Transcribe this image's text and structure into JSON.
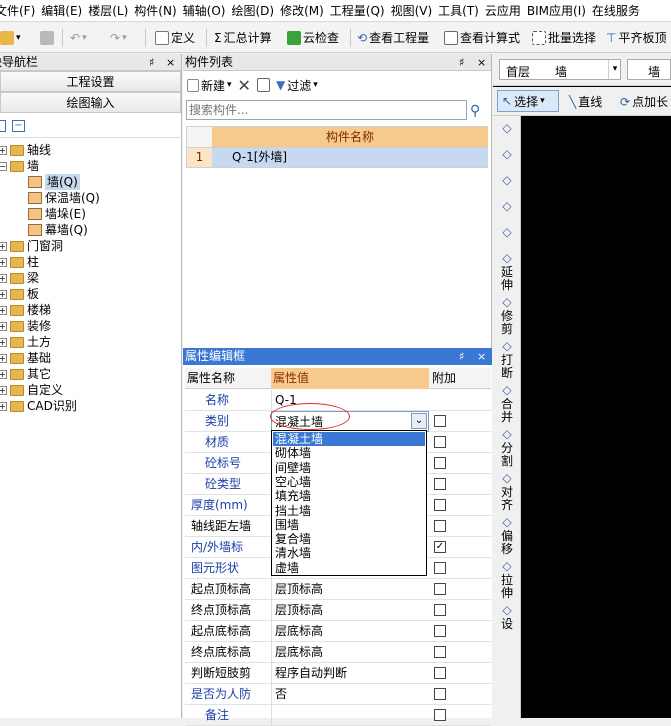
{
  "menu": [
    "文件(F)",
    "编辑(E)",
    "楼层(L)",
    "构件(N)",
    "辅轴(O)",
    "绘图(D)",
    "修改(M)",
    "工程量(Q)",
    "视图(V)",
    "工具(T)",
    "云应用",
    "BIM应用(I)",
    "在线服务"
  ],
  "toolbar": {
    "define": "定义",
    "sum": "汇总计算",
    "cloud_check": "云检查",
    "view_quantity": "查看工程量",
    "view_formula": "查看计算式",
    "batch_select": "批量选择",
    "flush_top": "平齐板顶"
  },
  "nav": {
    "title": "模块导航栏",
    "pin": "♯",
    "close": "×",
    "btn_project": "工程设置",
    "btn_draw": "绘图输入",
    "tree": [
      {
        "label": "轴线",
        "level": 0,
        "expand": "+",
        "type": "folder"
      },
      {
        "label": "墙",
        "level": 0,
        "expand": "-",
        "type": "folder"
      },
      {
        "label": "墙(Q)",
        "level": 1,
        "type": "wall",
        "selected": true
      },
      {
        "label": "保温墙(Q)",
        "level": 1,
        "type": "wall"
      },
      {
        "label": "墙垛(E)",
        "level": 1,
        "type": "wall"
      },
      {
        "label": "幕墙(Q)",
        "level": 1,
        "type": "wall"
      },
      {
        "label": "门窗洞",
        "level": 0,
        "expand": "+",
        "type": "folder"
      },
      {
        "label": "柱",
        "level": 0,
        "expand": "+",
        "type": "folder"
      },
      {
        "label": "梁",
        "level": 0,
        "expand": "+",
        "type": "folder"
      },
      {
        "label": "板",
        "level": 0,
        "expand": "+",
        "type": "folder"
      },
      {
        "label": "楼梯",
        "level": 0,
        "expand": "+",
        "type": "folder"
      },
      {
        "label": "装修",
        "level": 0,
        "expand": "+",
        "type": "folder"
      },
      {
        "label": "土方",
        "level": 0,
        "expand": "+",
        "type": "folder"
      },
      {
        "label": "基础",
        "level": 0,
        "expand": "+",
        "type": "folder"
      },
      {
        "label": "其它",
        "level": 0,
        "expand": "+",
        "type": "folder"
      },
      {
        "label": "自定义",
        "level": 0,
        "expand": "+",
        "type": "folder"
      },
      {
        "label": "CAD识别",
        "level": 0,
        "expand": "+",
        "type": "folder"
      }
    ]
  },
  "complist": {
    "title": "构件列表",
    "new_label": "新建",
    "filter_label": "过滤",
    "search_placeholder": "搜索构件...",
    "column": "构件名称",
    "rows": [
      {
        "num": "1",
        "name": "Q-1[外墙]"
      }
    ]
  },
  "props": {
    "title": "属性编辑框",
    "col_name": "属性名称",
    "col_value": "属性值",
    "col_extra": "附加",
    "rows": [
      {
        "name": "名称",
        "value": "Q-1",
        "blue": true,
        "check": null
      },
      {
        "name": "类别",
        "value": "混凝土墙",
        "blue": true,
        "check": false
      },
      {
        "name": "材质",
        "value": "",
        "blue": true,
        "check": false
      },
      {
        "name": "砼标号",
        "value": "",
        "blue": true,
        "check": false
      },
      {
        "name": "砼类型",
        "value": "",
        "blue": true,
        "check": false
      },
      {
        "name": "厚度(mm)",
        "value": "",
        "blue": true,
        "check": false
      },
      {
        "name": "轴线距左墙",
        "value": "",
        "blue": false,
        "check": false
      },
      {
        "name": "内/外墙标",
        "value": "",
        "blue": true,
        "check": true
      },
      {
        "name": "图元形状",
        "value": "",
        "blue": true,
        "check": false
      },
      {
        "name": "起点顶标高",
        "value": "层顶标高",
        "blue": false,
        "check": false
      },
      {
        "name": "终点顶标高",
        "value": "层顶标高",
        "blue": false,
        "check": false
      },
      {
        "name": "起点底标高",
        "value": "层底标高",
        "blue": false,
        "check": false
      },
      {
        "name": "终点底标高",
        "value": "层底标高",
        "blue": false,
        "check": false
      },
      {
        "name": "判断短肢剪",
        "value": "程序自动判断",
        "blue": false,
        "check": false
      },
      {
        "name": "是否为人防",
        "value": "否",
        "blue": true,
        "check": false
      },
      {
        "name": "备注",
        "value": "",
        "blue": true,
        "check": false
      }
    ],
    "dropdown": [
      "混凝土墙",
      "砌体墙",
      "间壁墙",
      "空心墙",
      "填充墙",
      "挡土墙",
      "围墙",
      "复合墙",
      "清水墙",
      "虚墙"
    ]
  },
  "right": {
    "floor_select": "首层",
    "type_select": "墙",
    "type_select2": "墙",
    "select_label": "选择",
    "line_label": "直线",
    "point_label": "点加长",
    "vtools": [
      {
        "label": "",
        "icon": "brush"
      },
      {
        "label": "",
        "icon": "copy"
      },
      {
        "label": "",
        "icon": "mirror"
      },
      {
        "label": "",
        "icon": "move"
      },
      {
        "label": "",
        "icon": "rotate"
      },
      {
        "label": "延伸",
        "icon": "extend"
      },
      {
        "label": "修剪",
        "icon": "trim"
      },
      {
        "label": "打断",
        "icon": "break"
      },
      {
        "label": "合并",
        "icon": "merge"
      },
      {
        "label": "分割",
        "icon": "split"
      },
      {
        "label": "对齐",
        "icon": "align"
      },
      {
        "label": "偏移",
        "icon": "offset"
      },
      {
        "label": "拉伸",
        "icon": "stretch"
      },
      {
        "label": "设",
        "icon": "set"
      }
    ]
  }
}
